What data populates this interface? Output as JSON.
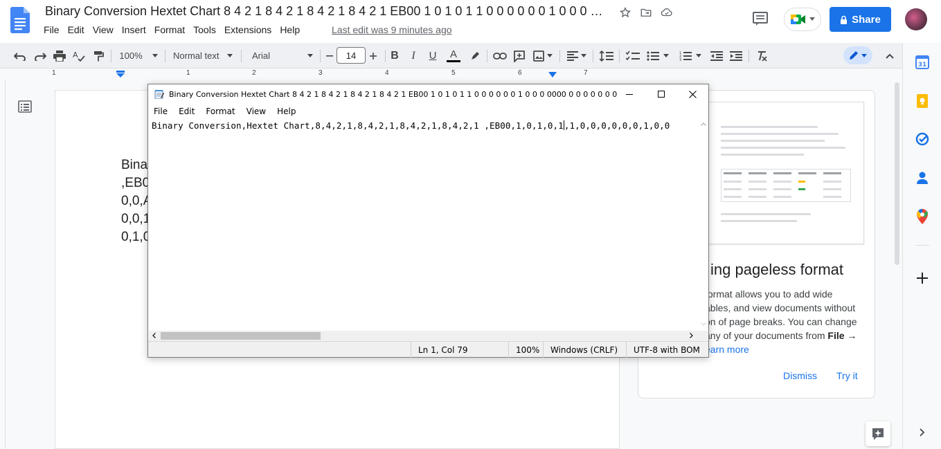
{
  "docs": {
    "title": "Binary Conversion Hextet Chart 8 4 2 1 8 4 2 1 8 4 2 1 8 4 2 1 EB00 1 0 1 0 1 1 0 0 0 0 0 0 1 0 0 0 000...",
    "menu": [
      "File",
      "Edit",
      "View",
      "Insert",
      "Format",
      "Tools",
      "Extensions",
      "Help"
    ],
    "last_edit": "Last edit was 9 minutes ago",
    "share_label": "Share",
    "toolbar": {
      "zoom": "100%",
      "style": "Normal text",
      "font": "Arial",
      "font_size": "14"
    },
    "ruler_numbers": [
      "1",
      "1",
      "2",
      "3",
      "4",
      "5",
      "6",
      "7"
    ],
    "body_lines": [
      "Bina",
      ",EB0",
      "0,0,A",
      "0,0,1",
      "0,1,0"
    ],
    "side_panel": {
      "title": "ing pageless format",
      "body_line1": "format allows you to add wide",
      "body_line2": "ables, and view documents without",
      "body_line3": "on of page breaks. You can change",
      "body_line4_pre": "any of your documents from ",
      "body_line4_bold": "File →",
      "learn_more": "earn more",
      "dismiss": "Dismiss",
      "try_it": "Try it"
    }
  },
  "notepad": {
    "title": "Binary Conversion Hextet Chart 8 4 2 1 8 4 2 1 8 4 2 1 8 4 2 1 EB00 1 0 1 0 1 1 0 0 0 0 0 0 1  0 0 0 0000 0 0 0 0 0 0 0 0 0 0 0 0 0 0 0 0 0 ...",
    "menu": [
      "File",
      "Edit",
      "Format",
      "View",
      "Help"
    ],
    "text_before_caret": "Binary Conversion,Hextet Chart,8,4,2,1,8,4,2,1,8,4,2,1,8,4,2,1 ,EB00,1,0,1,0,1",
    "text_after_caret": ",1,0,0,0,0,0,0,1,0,0",
    "status": {
      "position": "Ln 1, Col 79",
      "zoom": "100%",
      "line_ending": "Windows (CRLF)",
      "encoding": "UTF-8 with BOM"
    }
  },
  "colors": {
    "accent": "#1a73e8",
    "toolbar_bg": "#eef0f3",
    "doc_blue": "#4285f4"
  }
}
